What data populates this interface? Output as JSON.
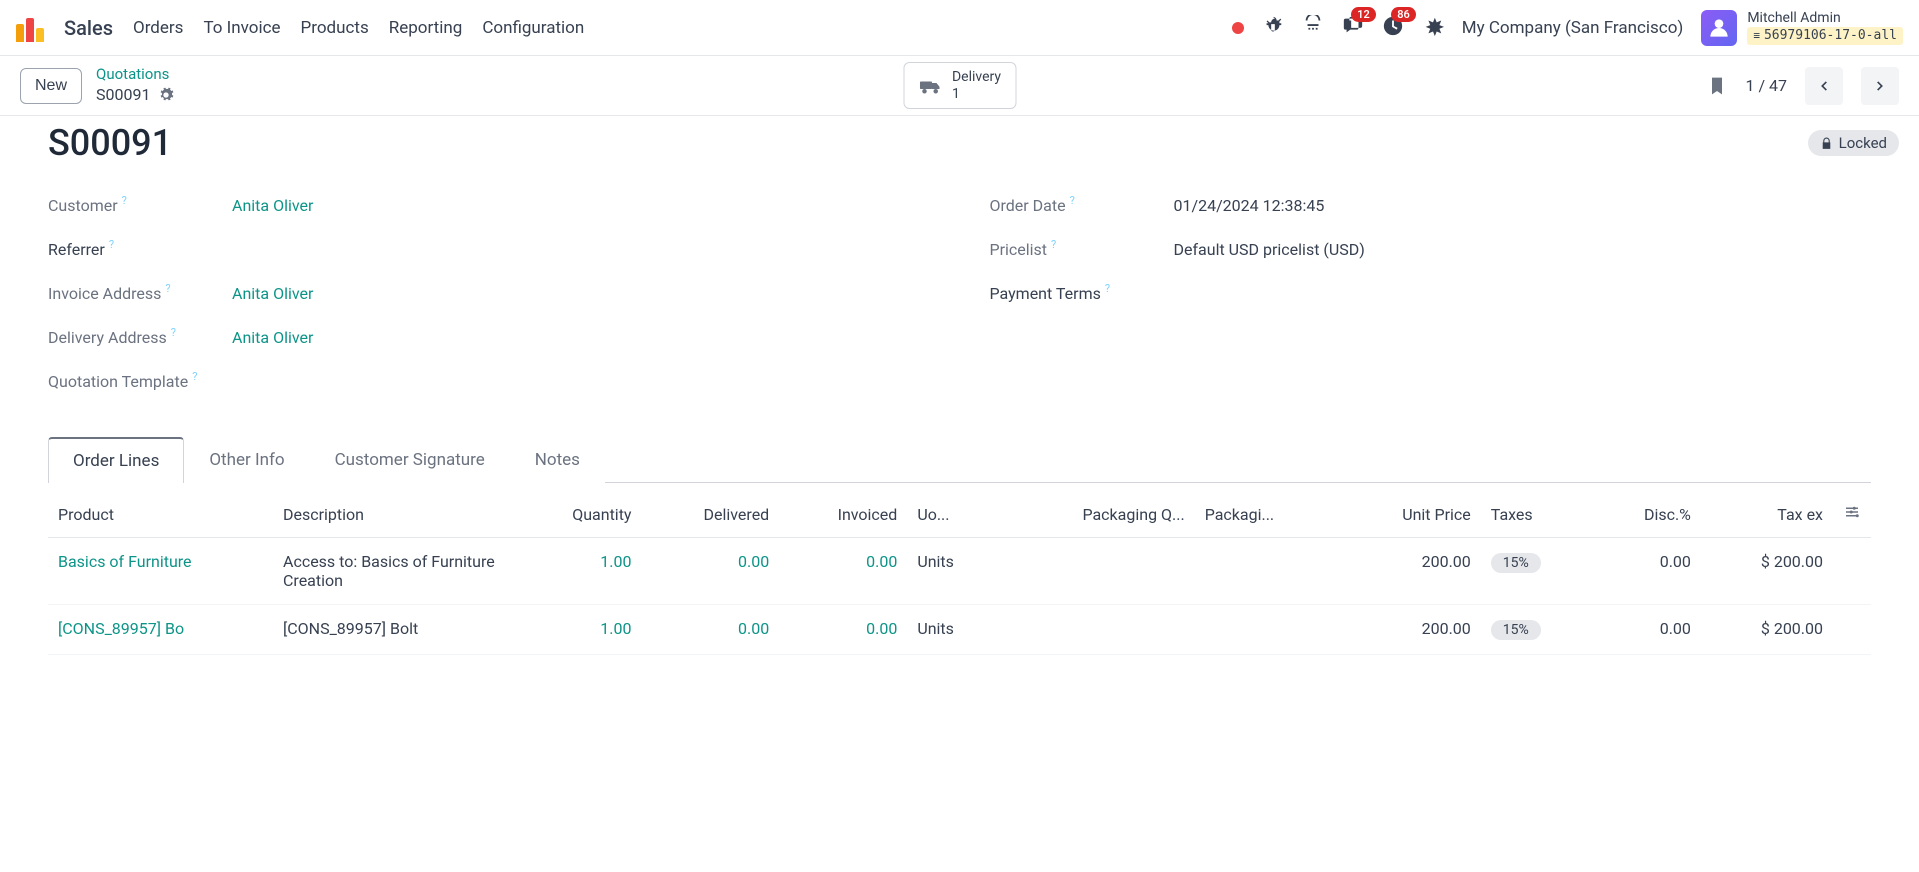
{
  "app": {
    "name": "Sales"
  },
  "nav": [
    "Orders",
    "To Invoice",
    "Products",
    "Reporting",
    "Configuration"
  ],
  "badges": {
    "messages": "12",
    "activities": "86"
  },
  "company": "My Company (San Francisco)",
  "user": {
    "name": "Mitchell Admin",
    "db": "56979106-17-0-all"
  },
  "subbar": {
    "new": "New",
    "breadcrumb_link": "Quotations",
    "breadcrumb_current": "S00091",
    "stat_label": "Delivery",
    "stat_count": "1",
    "pager": "1 / 47"
  },
  "record": {
    "title": "S00091",
    "locked": "Locked",
    "left": {
      "customer_label": "Customer",
      "customer_value": "Anita Oliver",
      "referrer_label": "Referrer",
      "invoice_label": "Invoice Address",
      "invoice_value": "Anita Oliver",
      "delivery_label": "Delivery Address",
      "delivery_value": "Anita Oliver",
      "template_label": "Quotation Template"
    },
    "right": {
      "order_date_label": "Order Date",
      "order_date_value": "01/24/2024 12:38:45",
      "pricelist_label": "Pricelist",
      "pricelist_value": "Default USD pricelist (USD)",
      "payment_label": "Payment Terms"
    }
  },
  "tabs": [
    "Order Lines",
    "Other Info",
    "Customer Signature",
    "Notes"
  ],
  "table": {
    "headers": [
      "Product",
      "Description",
      "Quantity",
      "Delivered",
      "Invoiced",
      "Uo...",
      "Packaging Q...",
      "Packagi...",
      "Unit Price",
      "Taxes",
      "Disc.%",
      "Tax ex"
    ],
    "rows": [
      {
        "product": "Basics of Furniture",
        "description": "Access to: Basics of Furniture Creation",
        "qty": "1.00",
        "delivered": "0.00",
        "invoiced": "0.00",
        "uom": "Units",
        "pack_qty": "",
        "pack": "",
        "unit_price": "200.00",
        "taxes": "15%",
        "disc": "0.00",
        "tax_ex": "$ 200.00"
      },
      {
        "product": "[CONS_89957] Bo",
        "description": "[CONS_89957] Bolt",
        "qty": "1.00",
        "delivered": "0.00",
        "invoiced": "0.00",
        "uom": "Units",
        "pack_qty": "",
        "pack": "",
        "unit_price": "200.00",
        "taxes": "15%",
        "disc": "0.00",
        "tax_ex": "$ 200.00"
      }
    ]
  }
}
